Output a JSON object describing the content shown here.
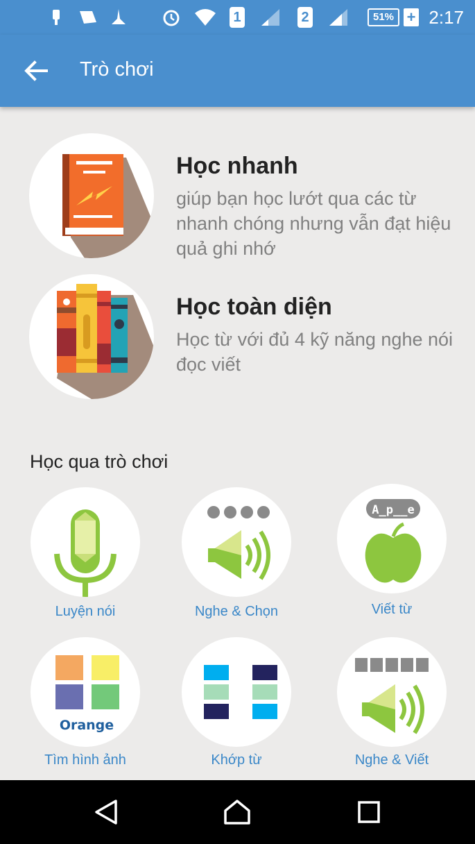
{
  "status_bar": {
    "time": "2:17",
    "battery": "51%",
    "sim1": "1",
    "sim2": "2",
    "icons": [
      "usb-icon",
      "sd-card-icon",
      "notification-icon",
      "alarm-icon",
      "wifi-icon",
      "signal-icon",
      "battery-icon"
    ]
  },
  "app_bar": {
    "title": "Trò chơi",
    "back_icon": "arrow-left-icon"
  },
  "modes": [
    {
      "title": "Học nhanh",
      "description": "giúp bạn học lướt qua các từ nhanh chóng nhưng vẫn đạt hiệu quả ghi nhớ",
      "icon": "book-icon"
    },
    {
      "title": "Học toàn diện",
      "description": "Học từ với đủ 4 kỹ năng nghe nói đọc viết",
      "icon": "books-icon"
    }
  ],
  "games_section": {
    "title": "Học qua trò chơi"
  },
  "games": [
    {
      "label": "Luyện nói",
      "icon": "microphone-icon"
    },
    {
      "label": "Nghe & Chọn",
      "icon": "speaker-icon"
    },
    {
      "label": "Viết từ",
      "icon": "apple-icon",
      "badge": "A_p__e"
    },
    {
      "label": "Tìm hình ảnh",
      "icon": "color-squares-icon",
      "word": "Orange"
    },
    {
      "label": "Khớp từ",
      "icon": "match-squares-icon"
    },
    {
      "label": "Nghe & Viết",
      "icon": "speaker-icon"
    }
  ],
  "colors": {
    "primary": "#4a8fce",
    "background": "#ecebea",
    "label_blue": "#3a87c8",
    "green": "#8dc63f"
  },
  "nav_bar": {
    "icons": [
      "back-triangle-icon",
      "home-icon",
      "recents-icon"
    ]
  }
}
